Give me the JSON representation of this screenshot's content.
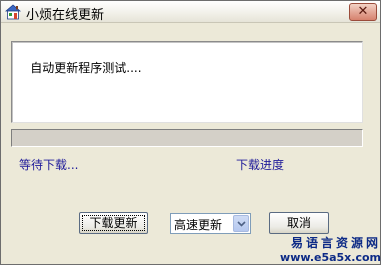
{
  "window": {
    "title": "小烦在线更新",
    "close_glyph": "✕"
  },
  "log": {
    "text": "自动更新程序测试...."
  },
  "progress": {
    "fraction": 0.0
  },
  "status": {
    "waiting_label": "等待下载...",
    "progress_label": "下载进度"
  },
  "buttons": {
    "download_label": "下载更新",
    "cancel_label": "取消"
  },
  "mode_select": {
    "selected": "高速更新"
  },
  "watermark": {
    "chinese": "易语言资源网",
    "url": "www.e5a5x.com"
  },
  "colors": {
    "label_text": "#1f1b9a",
    "window_bg": "#ece9d8",
    "watermark": "#0c2a86"
  }
}
